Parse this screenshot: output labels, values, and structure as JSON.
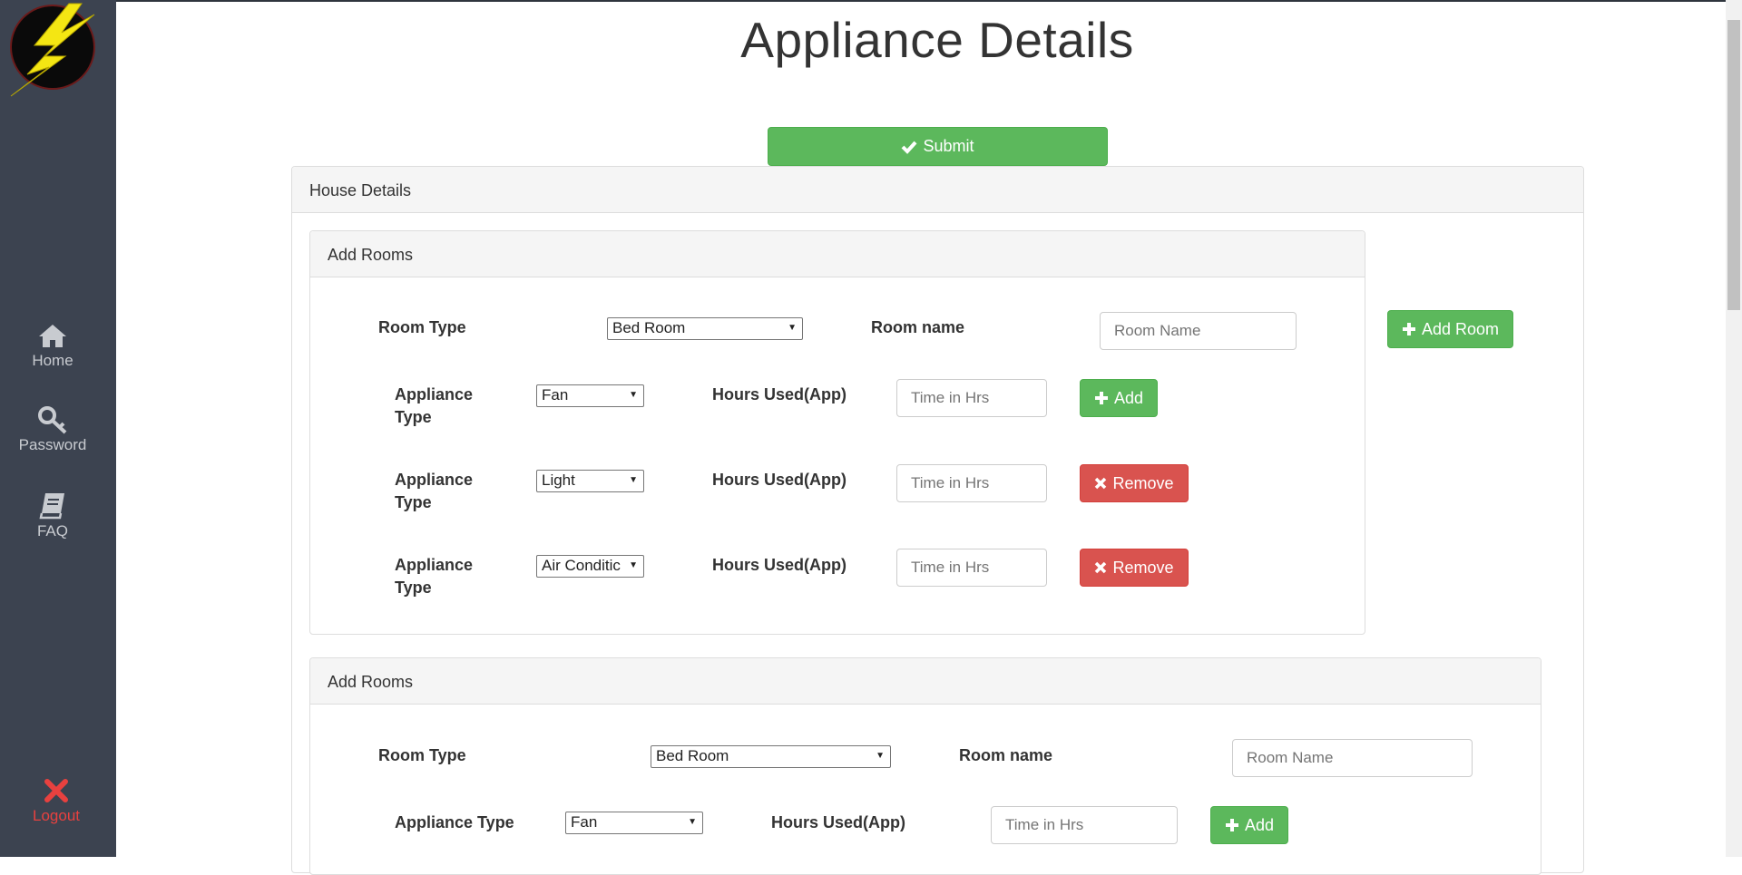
{
  "page": {
    "title": "Appliance Details"
  },
  "nav": {
    "home": "Home",
    "password": "Password",
    "faq": "FAQ",
    "logout": "Logout"
  },
  "actions": {
    "submit": "Submit",
    "add_room": "Add Room"
  },
  "house_panel": {
    "heading": "House Details"
  },
  "rooms": [
    {
      "heading": "Add Rooms",
      "room_type_label": "Room Type",
      "room_type_value": "Bed Room",
      "room_name_label": "Room name",
      "room_name_placeholder": "Room Name",
      "appliances": [
        {
          "type_label": "Appliance Type",
          "type_value": "Fan",
          "hours_label": "Hours Used(App)",
          "hours_placeholder": "Time in Hrs",
          "action": "Add"
        },
        {
          "type_label": "Appliance Type",
          "type_value": "Light",
          "hours_label": "Hours Used(App)",
          "hours_placeholder": "Time in Hrs",
          "action": "Remove"
        },
        {
          "type_label": "Appliance Type",
          "type_value": "Air Conditic",
          "hours_label": "Hours Used(App)",
          "hours_placeholder": "Time in Hrs",
          "action": "Remove"
        }
      ]
    },
    {
      "heading": "Add Rooms",
      "room_type_label": "Room Type",
      "room_type_value": "Bed Room",
      "room_name_label": "Room name",
      "room_name_placeholder": "Room Name",
      "appliances": [
        {
          "type_label": "Appliance Type",
          "type_value": "Fan",
          "hours_label": "Hours Used(App)",
          "hours_placeholder": "Time in Hrs",
          "action": "Add"
        }
      ]
    }
  ],
  "colors": {
    "sidebar_bg": "#3c4350",
    "success": "#5cb85c",
    "danger": "#d9534f",
    "logout": "#e8413f"
  }
}
